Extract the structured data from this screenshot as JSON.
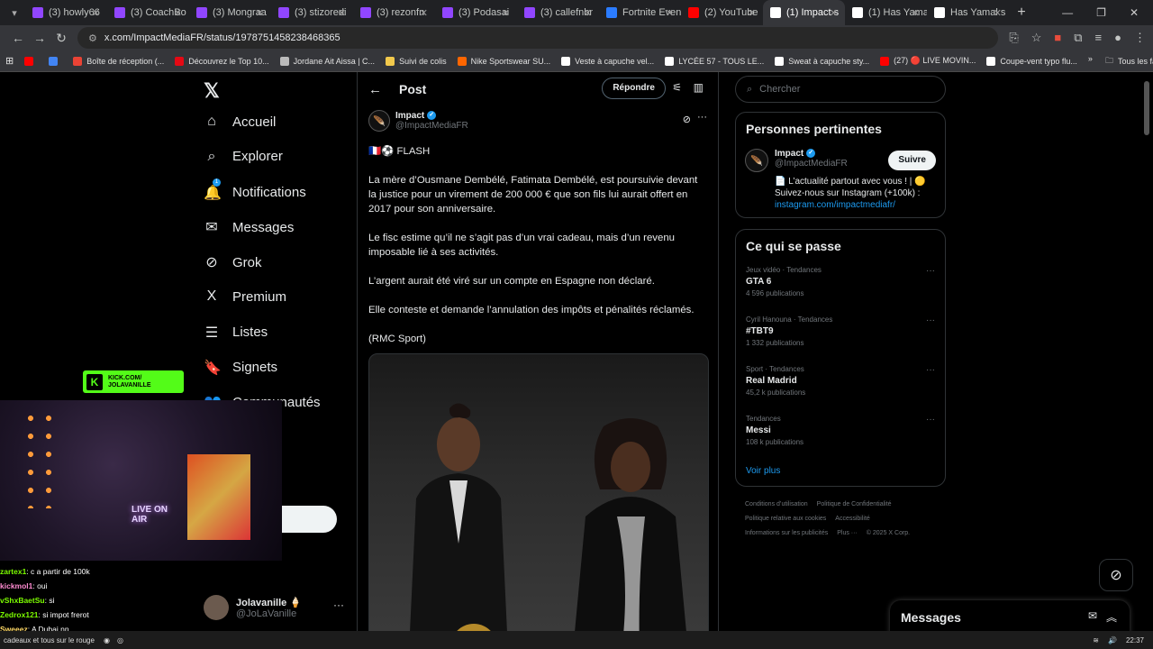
{
  "browser": {
    "tabs": [
      {
        "title": "(3) howly66",
        "color": "#9146ff"
      },
      {
        "title": "(3) CoachBo",
        "color": "#9146ff"
      },
      {
        "title": "(3) Mongraa",
        "color": "#9146ff"
      },
      {
        "title": "(3) stizoredi",
        "color": "#9146ff"
      },
      {
        "title": "(3) rezonfn",
        "color": "#9146ff"
      },
      {
        "title": "(3) Podasai",
        "color": "#9146ff"
      },
      {
        "title": "(3) callefnbr",
        "color": "#9146ff"
      },
      {
        "title": "Fortnite Even",
        "color": "#2b7cff"
      },
      {
        "title": "(2) YouTube",
        "color": "#ff0000"
      },
      {
        "title": "(1) Impact s",
        "color": "#ffffff",
        "active": true
      },
      {
        "title": "(1) Has Yama",
        "color": "#ffffff"
      },
      {
        "title": "Has Yamal s",
        "color": "#ffffff"
      }
    ],
    "url": "x.com/ImpactMediaFR/status/1978751458238468365",
    "bookmarks": [
      {
        "label": "",
        "color": "#ff0000"
      },
      {
        "label": "",
        "color": "#4285f4"
      },
      {
        "label": "Boîte de réception (...",
        "color": "#ea4335"
      },
      {
        "label": "Découvrez le Top 10...",
        "color": "#e50914"
      },
      {
        "label": "Jordane Ait Aissa | C...",
        "color": "#bbbbbb"
      },
      {
        "label": "Suivi de colis",
        "color": "#f2c94c"
      },
      {
        "label": "Nike Sportswear SU...",
        "color": "#ff6600"
      },
      {
        "label": "Veste à capuche vel...",
        "color": "#ffffff"
      },
      {
        "label": "LYCÉE 57 - TOUS LE...",
        "color": "#ffffff"
      },
      {
        "label": "Sweat à capuche sty...",
        "color": "#ffffff"
      },
      {
        "label": "(27) 🔴 LIVE MOVIN...",
        "color": "#ff0000"
      },
      {
        "label": "Coupe-vent typo flu...",
        "color": "#ffffff"
      }
    ],
    "all_favorites": "Tous les favoris"
  },
  "nav": {
    "items": [
      {
        "label": "Accueil",
        "icon": "home-icon",
        "glyph": "⌂"
      },
      {
        "label": "Explorer",
        "icon": "search-icon",
        "glyph": "⌕"
      },
      {
        "label": "Notifications",
        "icon": "bell-icon",
        "glyph": "🔔"
      },
      {
        "label": "Messages",
        "icon": "envelope-icon",
        "glyph": "✉"
      },
      {
        "label": "Grok",
        "icon": "grok-icon",
        "glyph": "⊘"
      },
      {
        "label": "Premium",
        "icon": "x-premium-icon",
        "glyph": "X"
      },
      {
        "label": "Listes",
        "icon": "list-icon",
        "glyph": "☰"
      },
      {
        "label": "Signets",
        "icon": "bookmark-icon",
        "glyph": "🔖"
      },
      {
        "label": "Communautés",
        "icon": "communities-icon",
        "glyph": "👥"
      }
    ],
    "notification_badge": "1",
    "profile": {
      "name": "Jolavanille 🍦",
      "handle": "@JoLaVanille"
    }
  },
  "post": {
    "header_title": "Post",
    "reply_label": "Répondre",
    "author_name": "Impact",
    "author_handle": "@ImpactMediaFR",
    "flash": "🇫🇷⚽ FLASH",
    "paragraphs": [
      "La mère d’Ousmane Dembélé, Fatimata Dembélé, est poursuivie devant la justice pour un virement de 200 000 € que son fils lui aurait offert en 2017 pour son anniversaire.",
      "Le fisc estime qu’il ne s’agit pas d’un vrai cadeau, mais d’un revenu imposable lié à ses activités.",
      "L’argent aurait été viré sur un compte en Espagne non déclaré.",
      "Elle conteste et demande l’annulation des impôts et pénalités réclamés.",
      "(RMC Sport)"
    ]
  },
  "sidebar": {
    "search_placeholder": "Chercher",
    "relevant_title": "Personnes pertinentes",
    "person": {
      "name": "Impact",
      "handle": "@ImpactMediaFR",
      "follow_label": "Suivre",
      "bio": "📄 L’actualité partout avec vous ! | 🟡 Suivez-nous sur Instagram (+100k) :",
      "link": "instagram.com/impactmediafr/"
    },
    "trends_title": "Ce qui se passe",
    "trends": [
      {
        "meta": "Jeux vidéo · Tendances",
        "title": "GTA 6",
        "count": "4 596 publications"
      },
      {
        "meta": "Cyril Hanouna · Tendances",
        "title": "#TBT9",
        "count": "1 332 publications"
      },
      {
        "meta": "Sport · Tendances",
        "title": "Real Madrid",
        "count": "45,2 k publications"
      },
      {
        "meta": "Tendances",
        "title": "Messi",
        "count": "108 k publications"
      }
    ],
    "see_more": "Voir plus",
    "footer": [
      "Conditions d’utilisation",
      "Politique de Confidentialité",
      "Politique relative aux cookies",
      "Accessibilité",
      "Informations sur les publicités",
      "Plus ···",
      "© 2025 X Corp."
    ]
  },
  "messages_dock": {
    "title": "Messages"
  },
  "stream": {
    "kick_line1": "KICK.COM/",
    "kick_line2": "JOLAVANILLE",
    "onair": "LIVE ON AIR",
    "chat": [
      {
        "user": "zartex1",
        "color": "#7CFC00",
        "text": ": c a partir de 100k"
      },
      {
        "user": "kickmol1",
        "color": "#ff8bd1",
        "text": ": oui"
      },
      {
        "user": "vShxBaetSu",
        "color": "#7CFC00",
        "text": ": si"
      },
      {
        "user": "Zedrox121",
        "color": "#7CFC00",
        "text": ": si impot frerot"
      },
      {
        "user": "Sweeez",
        "color": "#ffd966",
        "text": ": A Dubai nn"
      }
    ]
  },
  "taskbar": {
    "ticker": "cadeaux et tous sur le rouge",
    "clock": "22:37"
  }
}
